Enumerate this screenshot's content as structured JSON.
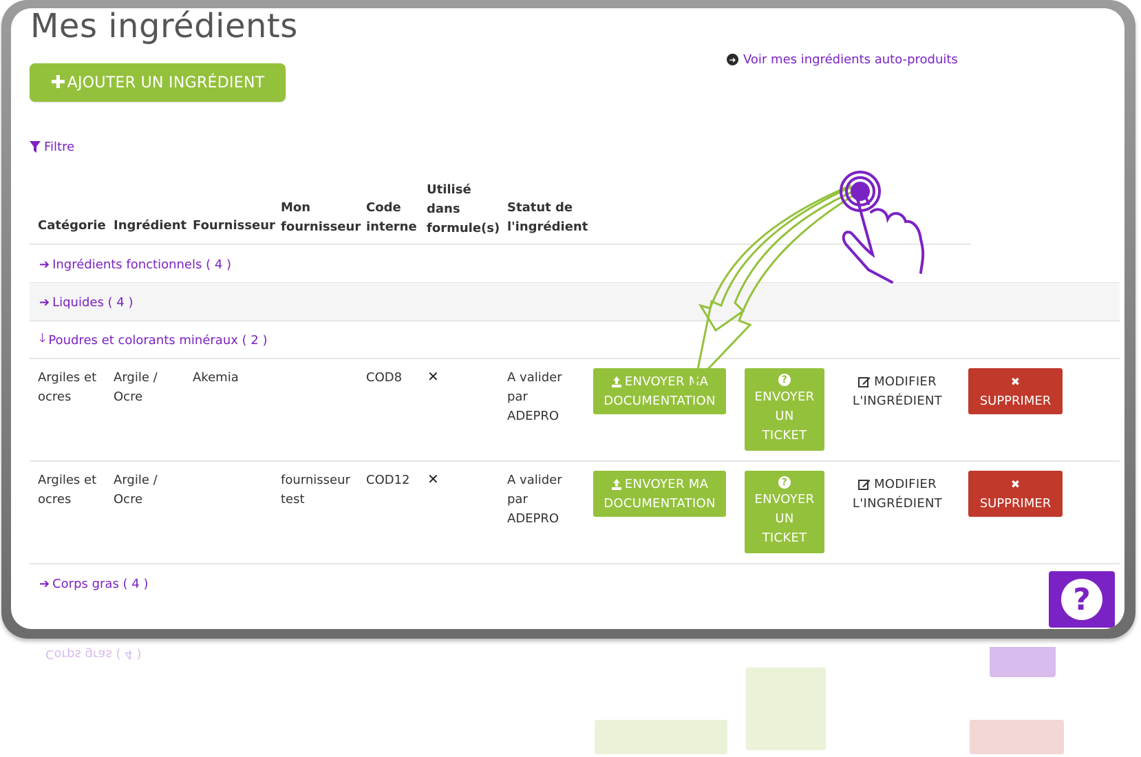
{
  "page": {
    "title": "Mes ingrédients",
    "add_button": "AJOUTER UN INGRÉDIENT",
    "auto_link": "Voir mes ingrédients auto-produits",
    "filter": "Filtre"
  },
  "table": {
    "headers": {
      "category": "Catégorie",
      "ingredient": "Ingrédient",
      "supplier": "Fournisseur",
      "my_supplier_1": "Mon",
      "my_supplier_2": "fournisseur",
      "code_1": "Code",
      "code_2": "interne",
      "used_1": "Utilisé",
      "used_2": "dans",
      "used_3": "formule(s)",
      "status_1": "Statut de",
      "status_2": "l'ingrédient"
    },
    "groups": [
      {
        "label": "Ingrédients fonctionnels ( 4 )"
      },
      {
        "label": "Liquides ( 4 )"
      },
      {
        "label": "Poudres et colorants minéraux ( 2 )"
      },
      {
        "label": "Corps gras ( 4 )"
      }
    ],
    "rows": [
      {
        "category_1": "Argiles et",
        "category_2": "ocres",
        "ingredient_1": "Argile /",
        "ingredient_2": "Ocre",
        "supplier": "Akemia",
        "my_supplier_1": "",
        "my_supplier_2": "",
        "code": "COD8",
        "used": "✕",
        "status_1": "A valider",
        "status_2": "par",
        "status_3": "ADEPRO"
      },
      {
        "category_1": "Argiles et",
        "category_2": "ocres",
        "ingredient_1": "Argile /",
        "ingredient_2": "Ocre",
        "supplier": "",
        "my_supplier_1": "fournisseur",
        "my_supplier_2": "test",
        "code": "COD12",
        "used": "✕",
        "status_1": "A valider",
        "status_2": "par",
        "status_3": "ADEPRO"
      }
    ]
  },
  "actions": {
    "send_doc_1": "ENVOYER MA",
    "send_doc_2": "DOCUMENTATION",
    "ticket_1": "ENVOYER",
    "ticket_2": "UN",
    "ticket_3": "TICKET",
    "edit_1": "MODIFIER",
    "edit_2": "L'INGRÉDIENT",
    "delete": "SUPPRIMER"
  },
  "colors": {
    "accent": "#7b22c4",
    "green": "#94c13c",
    "red": "#c0392b"
  },
  "icons": [
    "plus-icon",
    "circle-arrow-right-icon",
    "filter-icon",
    "arrow-right-icon",
    "arrow-down-icon",
    "upload-icon",
    "question-circle-icon",
    "edit-icon",
    "close-icon",
    "help-icon",
    "hand-pointer-icon"
  ]
}
